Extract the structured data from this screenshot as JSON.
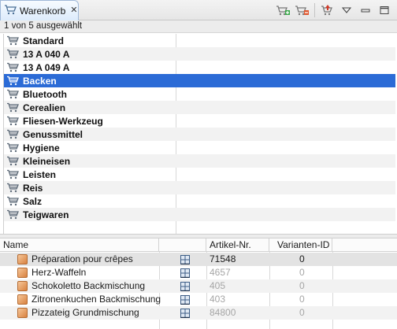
{
  "tab": {
    "title": "Warenkorb",
    "close_glyph": "✕"
  },
  "toolbar": {
    "icons": [
      "cart-add-icon",
      "cart-remove-icon",
      "upload-icon",
      "view-menu-icon",
      "minimize-icon",
      "maximize-icon"
    ]
  },
  "status": "1 von 5 ausgewählt",
  "carts": [
    {
      "label": "Standard",
      "selected": false
    },
    {
      "label": "13 A 040 A",
      "selected": false
    },
    {
      "label": "13 A 049 A",
      "selected": false
    },
    {
      "label": "Backen",
      "selected": true
    },
    {
      "label": "Bluetooth",
      "selected": false
    },
    {
      "label": "Cerealien",
      "selected": false
    },
    {
      "label": "Fliesen-Werkzeug",
      "selected": false
    },
    {
      "label": "Genussmittel",
      "selected": false
    },
    {
      "label": "Hygiene",
      "selected": false
    },
    {
      "label": "Kleineisen",
      "selected": false
    },
    {
      "label": "Leisten",
      "selected": false
    },
    {
      "label": "Reis",
      "selected": false
    },
    {
      "label": "Salz",
      "selected": false
    },
    {
      "label": "Teigwaren",
      "selected": false
    }
  ],
  "table": {
    "headers": {
      "name": "Name",
      "article_no": "Artikel-Nr.",
      "variant_id": "Varianten-ID"
    },
    "rows": [
      {
        "name": "Préparation pour crêpes",
        "article_no": "71548",
        "variant_id": "0",
        "active": true
      },
      {
        "name": "Herz-Waffeln",
        "article_no": "4657",
        "variant_id": "0",
        "active": false
      },
      {
        "name": "Schokoletto Backmischung",
        "article_no": "405",
        "variant_id": "0",
        "active": false
      },
      {
        "name": "Zitronenkuchen Backmischung",
        "article_no": "403",
        "variant_id": "0",
        "active": false
      },
      {
        "name": "Pizzateig Grundmischung",
        "article_no": "84800",
        "variant_id": "0",
        "active": false
      }
    ]
  },
  "colors": {
    "selection": "#2b6bd6",
    "row_alt": "#f2f2f2",
    "dim_text": "#a6a6a6"
  }
}
